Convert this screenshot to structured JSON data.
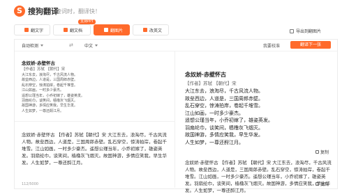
{
  "header": {
    "logo_mark": "S",
    "logo_text": "搜狗翻译",
    "slogan": "查词时，翻译快！"
  },
  "tabs": [
    {
      "label": "翻文字",
      "icon": "text-icon"
    },
    {
      "label": "翻文档",
      "icon": "document-icon"
    },
    {
      "label": "翻图片",
      "icon": "image-icon"
    },
    {
      "label": "改英文",
      "icon": "edit-icon"
    }
  ],
  "badge": "支持PPT",
  "export_label": "导出到翻图片",
  "toolbar": {
    "source_lang": "自动检测",
    "swap": "⇄",
    "target_lang": "中文",
    "pro_label": "我要校准",
    "next_label": "翻译下一张"
  },
  "source": {
    "title": "念奴娇·赤壁怀古",
    "meta": "【作者】苏轼 【朝代】宋",
    "lines": [
      "大江东去，浪淘尽，千古风流人物。",
      "故垒西边，人道是，三国周郎赤壁。",
      "乱石穿空，惊涛拍岸，卷起千堆雪。",
      "江山如画，一时多少豪杰。",
      "遥想公瑾当年，小乔初嫁了，雄姿英发。",
      "羽扇纶巾，谈笑间，樯橹灰飞烟灭。",
      "故国神游，多情应笑我，早生华发。",
      "人生如梦，一尊还酹江月。"
    ],
    "paragraph": "念奴娇·赤壁怀古 【作者】苏轼【朝代】宋 大江东去，浪淘尽，千古风流人物。故垒西边，人道是，三国周郎赤壁。乱石穿空，惊涛拍岸，卷起千堆雪。江山如画，一时多少豪杰。遥想公瑾当年，小乔初嫁了，雄姿英发。羽扇纶巾，谈笑间，樯橹灰飞烟灭。故国神游，多情应笑我，早生华发。人生如梦，一尊还酹江月。",
    "count": "112/5000"
  },
  "target": {
    "title": "念奴娇·赤壁怀古",
    "meta": "【作者】苏轼 【朝代】宋",
    "lines": [
      "大江东去，浪淘尽，千古风流人物。",
      "故垒西边，人道是，三国周郎赤壁。",
      "乱石穿空，惊涛拍岸，卷起千堆雪。",
      "江山如画，一时多少豪杰。",
      "遥想公瑾当年，小乔初嫁了，雄姿英发。",
      "羽扇纶巾，谈笑间，樯橹灰飞烟灭。",
      "故国神游，多情应笑我，早生华发。",
      "人生如梦，一尊还酹江月。"
    ],
    "copy_label": "复制",
    "paragraph": "念奴娇·赤壁怀古 【作者】苏轼 【朝代】宋 大江东去，浪淘尽，千古风流人物。故垒西边，人道是，三国周郎赤壁。乱石穿空，惊涛拍岸，卷起千堆雪。江山如画，一时多少豪杰。遥想公瑾当年，小乔初嫁了，雄姿英发。羽扇纶巾，谈笑间，樯橹灰飞烟灭。故国神游，多情应笑我，早生华发。人生如梦，一尊还酹江月。",
    "copy_label2": "复制"
  },
  "colors": {
    "accent": "#ff6a2b"
  }
}
